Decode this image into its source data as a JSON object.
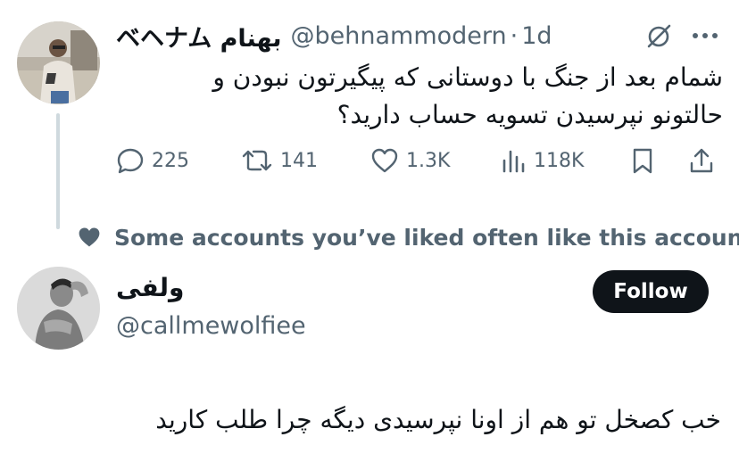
{
  "tweet": {
    "display_name": "ベヘナム بهنام",
    "handle": "@behnammodern",
    "separator": "·",
    "time": "1d",
    "text_line1": "شمام بعد از جنگ با دوستانی که پیگیرتون نبودن و",
    "text_line2": "حالتونو نپرسیدن تسویه حساب دارید؟",
    "stats": {
      "replies": "225",
      "retweets": "141",
      "likes": "1.3K",
      "views": "118K"
    },
    "icons": {
      "grok": "grok-icon",
      "more": "more-icon",
      "reply": "reply-icon",
      "retweet": "retweet-icon",
      "like": "heart-icon",
      "views": "views-icon",
      "bookmark": "bookmark-icon",
      "share": "share-icon"
    }
  },
  "social_context": {
    "text": "Some accounts you’ve liked often like this account",
    "icon": "heart-icon"
  },
  "recommended": {
    "display_name": "ولفی",
    "handle": "@callmewolfiee",
    "follow_label": "Follow",
    "bio": "خب کصخل تو هم از اونا نپرسیدی دیگه چرا طلب کارید"
  },
  "colors": {
    "text_primary": "#0f1419",
    "text_secondary": "#536471",
    "thread_line": "#cfd9de",
    "button_bg": "#0f1419",
    "button_text": "#ffffff"
  }
}
